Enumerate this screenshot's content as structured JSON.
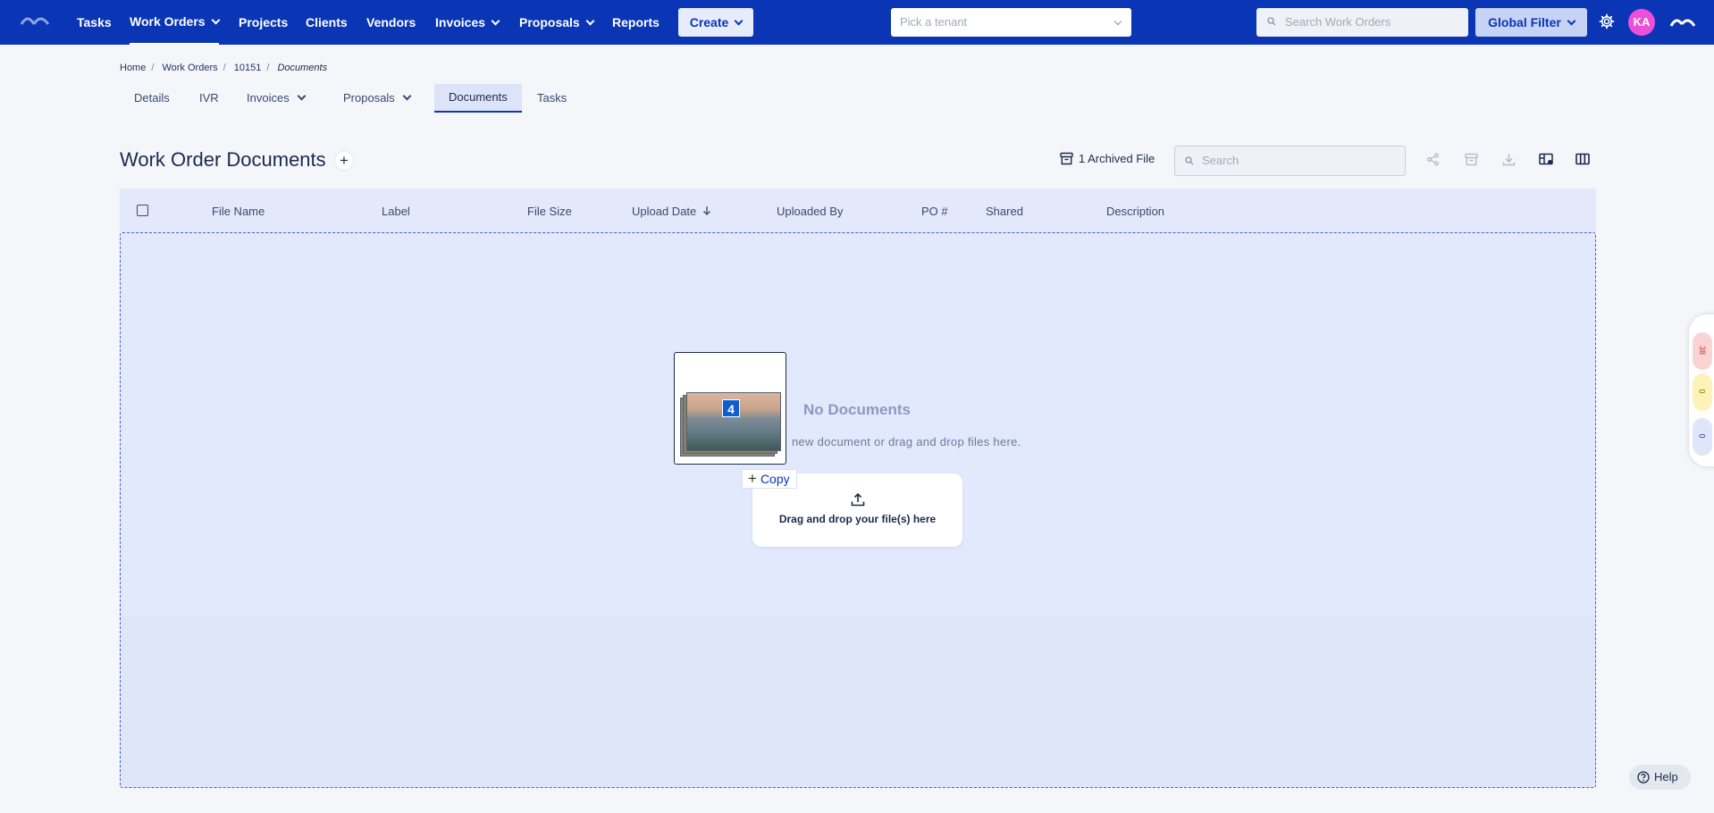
{
  "nav": {
    "items": [
      {
        "label": "Tasks"
      },
      {
        "label": "Work Orders"
      },
      {
        "label": "Projects"
      },
      {
        "label": "Clients"
      },
      {
        "label": "Vendors"
      },
      {
        "label": "Invoices"
      },
      {
        "label": "Proposals"
      },
      {
        "label": "Reports"
      }
    ],
    "create_label": "Create",
    "tenant_placeholder": "Pick a tenant",
    "search_placeholder": "Search Work Orders",
    "global_filter_label": "Global Filter",
    "avatar_initials": "KA",
    "brand_color": "#0a35b5"
  },
  "breadcrumb": [
    "Home",
    "Work Orders",
    "10151",
    "Documents"
  ],
  "tabs": [
    {
      "label": "Details"
    },
    {
      "label": "IVR"
    },
    {
      "label": "Invoices"
    },
    {
      "label": "Proposals"
    },
    {
      "label": "Documents"
    },
    {
      "label": "Tasks"
    }
  ],
  "page": {
    "title": "Work Order Documents",
    "archived_label": "1 Archived File",
    "search_placeholder": "Search"
  },
  "table": {
    "columns": [
      "File Name",
      "Label",
      "File Size",
      "Upload Date",
      "Uploaded By",
      "PO #",
      "Shared",
      "Description"
    ]
  },
  "empty_state": {
    "title": "No Documents",
    "subtitle": "new document or drag and drop files here."
  },
  "drag": {
    "count": "4",
    "copy_label": "Copy"
  },
  "upload": {
    "label": "Drag and drop your file(s) here"
  },
  "side_widget": {
    "red": "38",
    "yellow": "0",
    "blue": "0"
  },
  "help_label": "Help"
}
